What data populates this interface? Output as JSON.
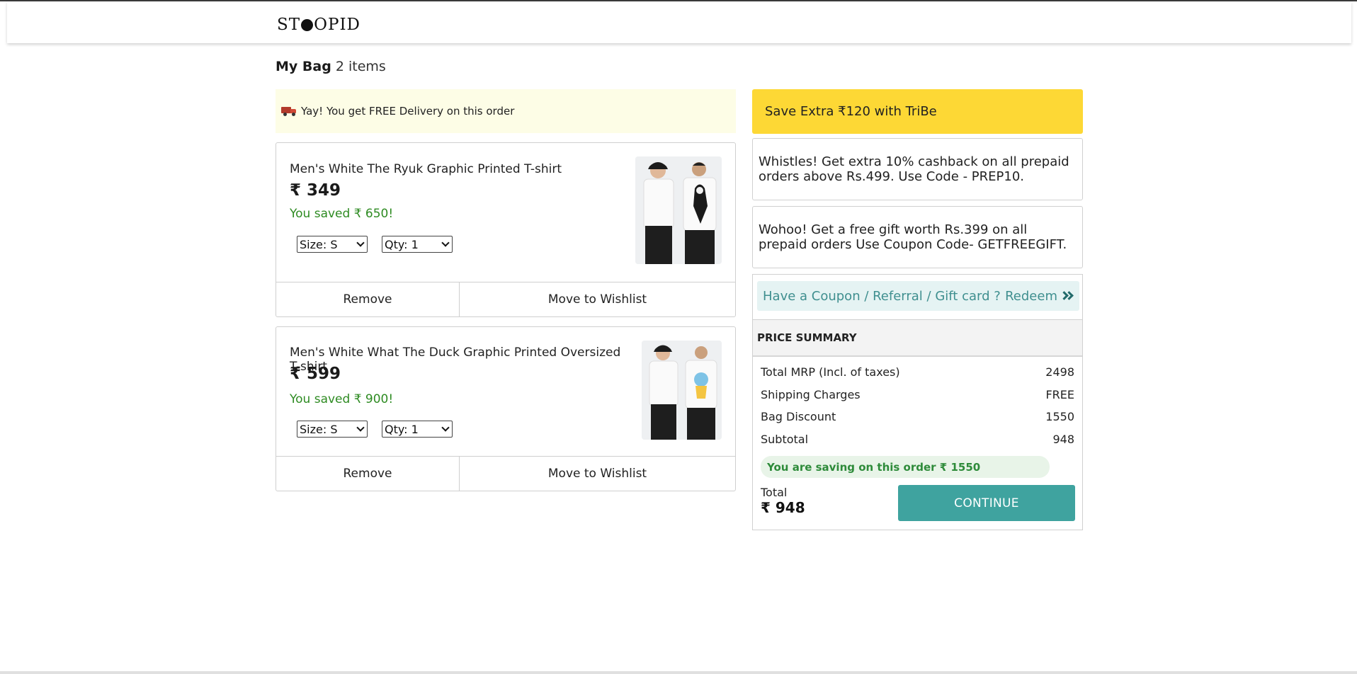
{
  "brand": {
    "left": "ST",
    "right": "OPID"
  },
  "bag": {
    "title": "My Bag",
    "count": "2 items"
  },
  "delivery_banner": "Yay! You get FREE Delivery on this order",
  "items": [
    {
      "name": "Men's White The Ryuk Graphic Printed T-shirt",
      "price": "₹ 349",
      "saved": "You saved ₹ 650!",
      "size": "Size: S",
      "qty": "Qty: 1",
      "remove": "Remove",
      "wishlist": "Move to Wishlist"
    },
    {
      "name": "Men's White What The Duck Graphic Printed Oversized T-shirt",
      "price": "₹ 599",
      "saved": "You saved ₹ 900!",
      "size": "Size: S",
      "qty": "Qty: 1",
      "remove": "Remove",
      "wishlist": "Move to Wishlist"
    }
  ],
  "tribe": "Save Extra ₹120 with TriBe",
  "offers": [
    "Whistles! Get extra 10% cashback on all prepaid orders above Rs.499. Use Code - PREP10.",
    "Wohoo! Get a free gift worth Rs.399 on all prepaid orders Use Coupon Code- GETFREEGIFT."
  ],
  "coupon": {
    "label": "Have a Coupon / Referral / Gift card ?",
    "action": "Redeem"
  },
  "summary": {
    "heading": "PRICE SUMMARY",
    "rows": [
      {
        "label": "Total MRP (Incl. of taxes)",
        "value": "2498"
      },
      {
        "label": "Shipping Charges",
        "value": "FREE"
      },
      {
        "label": "Bag Discount",
        "value": "1550"
      },
      {
        "label": "Subtotal",
        "value": "948"
      }
    ],
    "saving": "You are saving on this order ₹ 1550",
    "total_label": "Total",
    "total_value": "₹ 948",
    "continue": "CONTINUE"
  },
  "colors": {
    "accent": "#3fa39f",
    "tribe": "#fdd835",
    "saved": "#2e8b22"
  }
}
